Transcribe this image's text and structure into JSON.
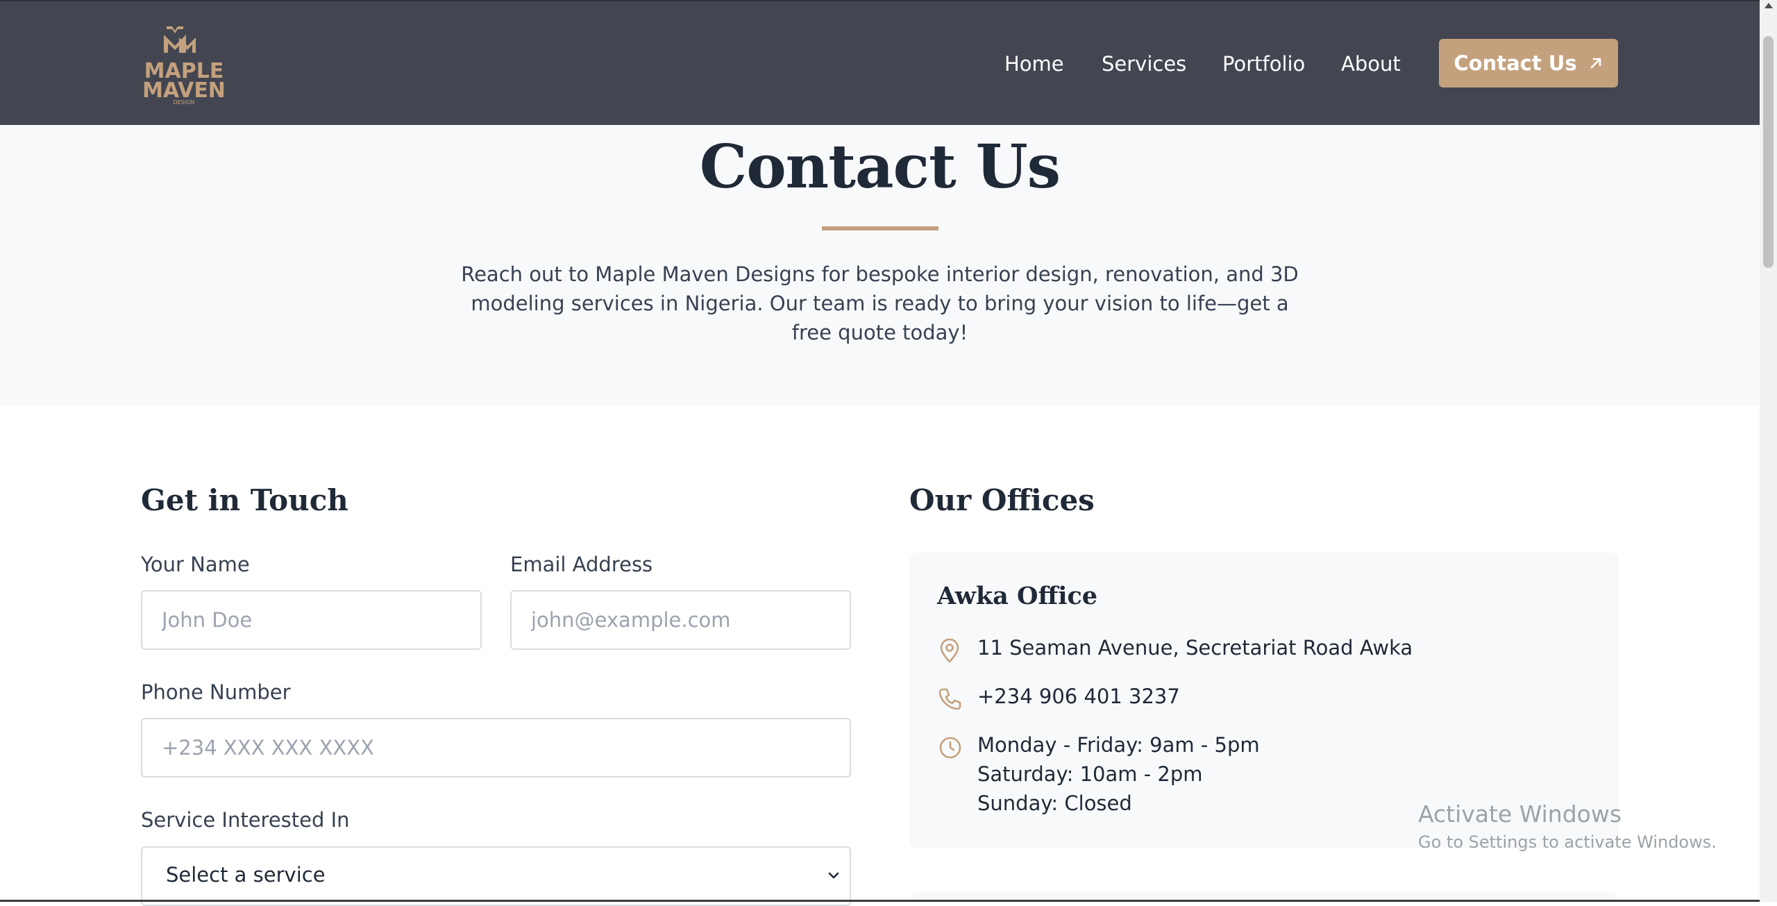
{
  "brand": {
    "logo_line1": "MAPLE",
    "logo_line2": "MAVEN",
    "logo_line3": "DESIGN",
    "accent_color": "#c4a17d",
    "nav_color": "#434650"
  },
  "nav": {
    "items": [
      {
        "label": "Home"
      },
      {
        "label": "Services"
      },
      {
        "label": "Portfolio"
      },
      {
        "label": "About"
      }
    ],
    "cta_label": "Contact Us",
    "cta_icon": "arrow-up-right-icon"
  },
  "hero": {
    "title": "Contact Us",
    "description": "Reach out to Maple Maven Designs for bespoke interior design, renovation, and 3D modeling services in Nigeria. Our team is ready to bring your vision to life—get a free quote today!"
  },
  "form": {
    "heading": "Get in Touch",
    "name_label": "Your Name",
    "name_placeholder": "John Doe",
    "email_label": "Email Address",
    "email_placeholder": "john@example.com",
    "phone_label": "Phone Number",
    "phone_placeholder": "+234 XXX XXX XXXX",
    "service_label": "Service Interested In",
    "service_selected": "Select a service"
  },
  "offices": {
    "heading": "Our Offices",
    "items": [
      {
        "name": "Awka Office",
        "address": "11 Seaman Avenue, Secretariat Road Awka",
        "phone": "+234 906 401 3237",
        "hours": [
          "Monday - Friday: 9am - 5pm",
          "Saturday: 10am - 2pm",
          "Sunday: Closed"
        ]
      }
    ]
  },
  "watermark": {
    "title": "Activate Windows",
    "subtitle": "Go to Settings to activate Windows."
  }
}
